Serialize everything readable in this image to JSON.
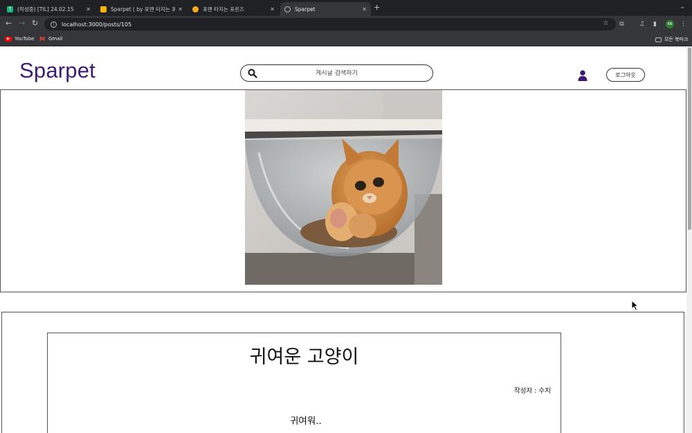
{
  "browser": {
    "tabs": [
      {
        "title": "(작성중) [TIL] 24.02.15",
        "favicon_color": "#1fb37b",
        "favicon_char": "T",
        "active": false
      },
      {
        "title": "Sparpet ( by 포멘 타지는 포린즈",
        "favicon_color": "#f4b400",
        "favicon_char": "",
        "active": false
      },
      {
        "title": "포멘 타지는 포린즈",
        "favicon_color": "#f9a825",
        "favicon_char": "😎",
        "active": false
      },
      {
        "title": "Sparpet",
        "favicon_color": "#5f6368",
        "favicon_char": "",
        "active": true
      }
    ],
    "url": "localhost:3000/posts/105",
    "profile_initials": "KN",
    "bookmarks": [
      {
        "label": "YouTube",
        "icon_color": "#ff0000"
      },
      {
        "label": "Gmail",
        "icon_color": "#ea4335"
      }
    ],
    "all_bookmarks_label": "모든 북마크"
  },
  "header": {
    "logo": "Sparpet",
    "search_placeholder": "게시글 검색하기",
    "logout_label": "로그아웃"
  },
  "post": {
    "title": "귀여운 고양이",
    "author": "작성자 : 수지",
    "body": "귀여워.."
  },
  "colors": {
    "brand": "#3d1b73",
    "chrome_dark": "#202124",
    "chrome_mid": "#35363a"
  }
}
